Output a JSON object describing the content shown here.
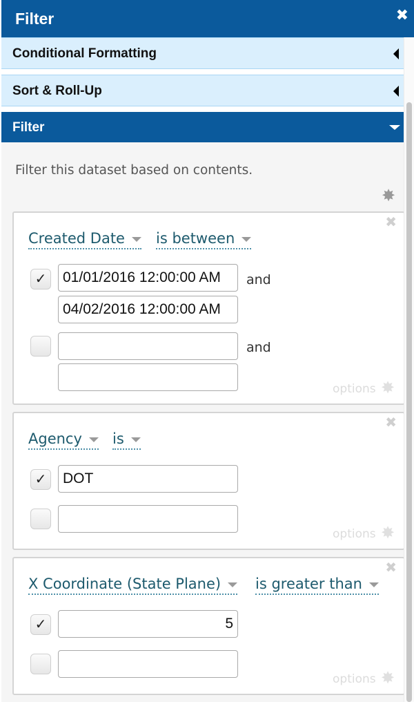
{
  "header": {
    "title": "Filter",
    "close_glyph": "✖"
  },
  "accordion": {
    "conditional_formatting": "Conditional Formatting",
    "sort_rollup": "Sort & Roll-Up",
    "filter": "Filter"
  },
  "panel": {
    "description": "Filter this dataset based on contents.",
    "gear_icon": "gear-icon"
  },
  "filters": [
    {
      "column": "Created Date",
      "operator": "is between",
      "rows": [
        {
          "checked": true,
          "value": "01/01/2016 12:00:00 AM",
          "value2": "04/02/2016 12:00:00 AM",
          "connector": "and"
        },
        {
          "checked": false,
          "value": "",
          "value2": "",
          "connector": "and"
        }
      ],
      "options_label": "options"
    },
    {
      "column": "Agency",
      "operator": "is",
      "rows": [
        {
          "checked": true,
          "value": "DOT"
        },
        {
          "checked": false,
          "value": ""
        }
      ],
      "options_label": "options"
    },
    {
      "column": "X Coordinate (State Plane)",
      "operator": "is greater than",
      "rows": [
        {
          "checked": true,
          "value": "5"
        },
        {
          "checked": false,
          "value": ""
        }
      ],
      "options_label": "options"
    }
  ],
  "glyphs": {
    "check": "✓",
    "remove": "✖",
    "gear": "✸"
  }
}
